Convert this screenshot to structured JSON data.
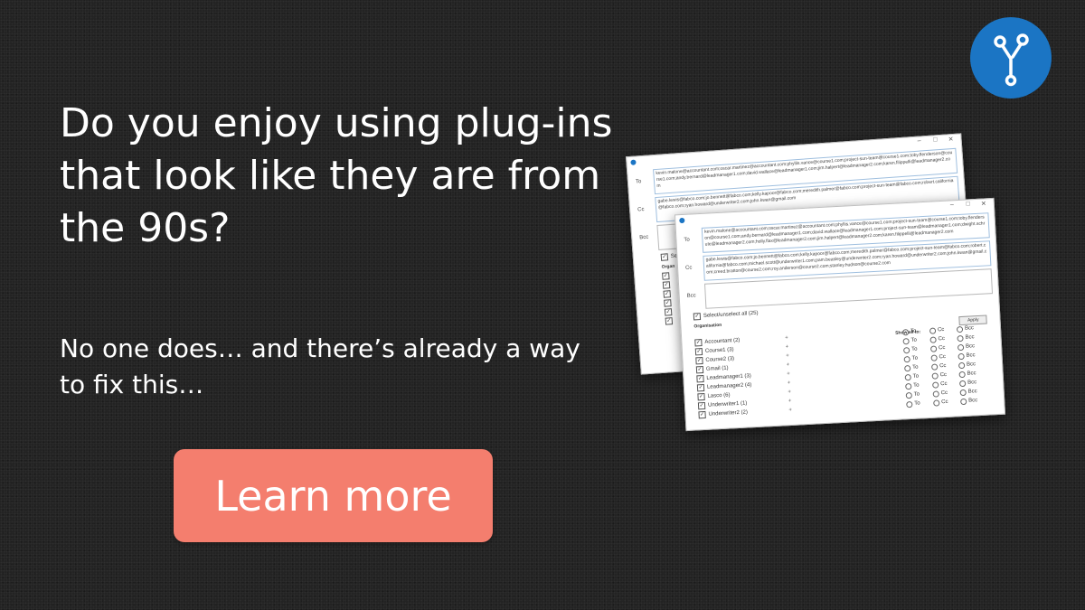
{
  "headline": "Do you enjoy using plug-ins that look like they are from the 90s?",
  "subline": "No one does… and there’s already a way to fix this…",
  "cta": {
    "label": "Learn more"
  },
  "colors": {
    "cta": "#f47e6e",
    "logo": "#1b75c4",
    "background": "#232323"
  },
  "logo": {
    "icon": "branch-icon"
  },
  "screenshot_back": {
    "to_label": "To",
    "to_value": "kevin.malone@accountant.com;oscar.martinez@accountant.com;phyllis.vance@course1.com;project-sun-team@course1.com;toby.flenderson@course1.com;andy.bernard@leadmanager1.com;david.wallace@leadmanager1.com;jim.halpert@leadmanager2.com;karen.filippelli@leadmanager2.com",
    "cc_label": "Cc",
    "cc_value": "gabe.lewis@fabco.com;jo.bennett@fabco.com;kelly.kapoor@fabco.com;meredith.palmer@fabco.com;project-sun-team@fabco.com;robert.california@fabco.com;ryan.howard@underwriter2.com;john.kwan@gmail.com",
    "bcc_label": "Bcc",
    "select_label": "Select",
    "org_label": "Organ"
  },
  "screenshot_front": {
    "to_label": "To",
    "to_value": "kevin.malone@accountant.com;oscar.martinez@accountant.com;phyllis.vance@course1.com;project-sun-team@course1.com;toby.flenderson@course1.com;andy.bernard@leadmanager1.com;david.wallace@leadmanager1.com;project-sun-team@leadmanager1.com;dwight.schrute@leadmanager2.com;holly.flax@leadmanager2.com;jim.halpert@leadmanager2.com;karen.filippelli@leadmanager2.com",
    "cc_label": "Cc",
    "cc_value": "gabe.lewis@fabco.com;jo.bennett@fabco.com;kelly.kapoor@fabco.com;meredith.palmer@fabco.com;project-sun-team@fabco.com;robert.california@fabco.com;michael.scott@underwriter1.com;pam.beasley@underwriter2.com;ryan.howard@underwriter2.com;john.kwan@gmail.com;creed.bratton@course2.com;roy.anderson@course2.com;stanley.hudson@course2.com",
    "bcc_label": "Bcc",
    "select_all_label": "Select/unselect all (25)",
    "organisation_label": "Organisation",
    "apply_label": "Apply",
    "show_all_label": "Show all to:",
    "recipient_options": [
      "To",
      "Cc",
      "Bcc"
    ],
    "organisations": [
      "Accountant (2)",
      "Course1 (3)",
      "Course2 (3)",
      "Gmail (1)",
      "Leadmanager1 (3)",
      "Leadmanager2 (4)",
      "Lasco (6)",
      "Underwriter1 (1)",
      "Underwriter2 (2)"
    ],
    "plus_symbol": "+"
  }
}
